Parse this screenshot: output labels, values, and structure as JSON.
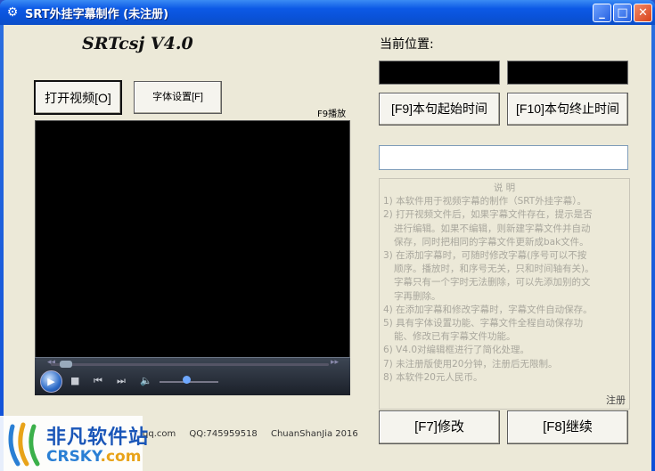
{
  "window": {
    "title": "SRT外挂字幕制作 (未注册)",
    "controls": {
      "minimize": "_",
      "maximize": "□",
      "close": "✕"
    }
  },
  "app": {
    "name": "SRTcsj V4.0",
    "open_video_label": "打开视频[O]",
    "font_settings_label": "字体设置[F]",
    "f9_play_label": "F9播放"
  },
  "position": {
    "label": "当前位置:",
    "start_time_value": "",
    "end_time_value": ""
  },
  "buttons": {
    "start_time": "[F9]本句起始时间",
    "end_time": "[F10]本句终止时间",
    "edit": "[F7]修改",
    "continue": "[F8]继续"
  },
  "subtitle_input": {
    "value": ""
  },
  "help": {
    "title": "说 明",
    "lines": [
      {
        "text": "1) 本软件用于视频字幕的制作（SRT外挂字幕）。",
        "cont": false
      },
      {
        "text": "2) 打开视频文件后，如果字幕文件存在，提示是否",
        "cont": false
      },
      {
        "text": "进行编辑。如果不编辑，则新建字幕文件并自动",
        "cont": true
      },
      {
        "text": "保存，同时把相同的字幕文件更新成bak文件。",
        "cont": true
      },
      {
        "text": "3) 在添加字幕时，可随时修改字幕(序号可以不按",
        "cont": false
      },
      {
        "text": "顺序。播放时，和序号无关，只和时间轴有关)。",
        "cont": true
      },
      {
        "text": "字幕只有一个字时无法删除，可以先添加别的文",
        "cont": true
      },
      {
        "text": "字再删除。",
        "cont": true
      },
      {
        "text": "4) 在添加字幕和修改字幕时，字幕文件自动保存。",
        "cont": false
      },
      {
        "text": "5) 具有字体设置功能、字幕文件全程自动保存功",
        "cont": false
      },
      {
        "text": "能、修改已有字幕文件功能。",
        "cont": true
      },
      {
        "text": "6) V4.0对编辑框进行了简化处理。",
        "cont": false
      },
      {
        "text": "7) 未注册版使用20分钟，注册后无限制。",
        "cont": false
      },
      {
        "text": "8) 本软件20元人民币。",
        "cont": false
      }
    ],
    "register_label": "注册"
  },
  "player": {
    "seek_fraction": 0.04,
    "volume_fraction": 0.45
  },
  "footer": {
    "email": "@qq.com",
    "qq": "QQ:745959518",
    "author": "ChuanShanJia 2016"
  },
  "watermark": {
    "cn": "非凡软件站",
    "en_main": "CRSKY",
    "en_suffix": ".com"
  },
  "colors": {
    "titlebar": "#0a52d8",
    "client_bg": "#ece9d8",
    "video_bg": "#000000",
    "watermark_blue": "#1a56b8"
  }
}
